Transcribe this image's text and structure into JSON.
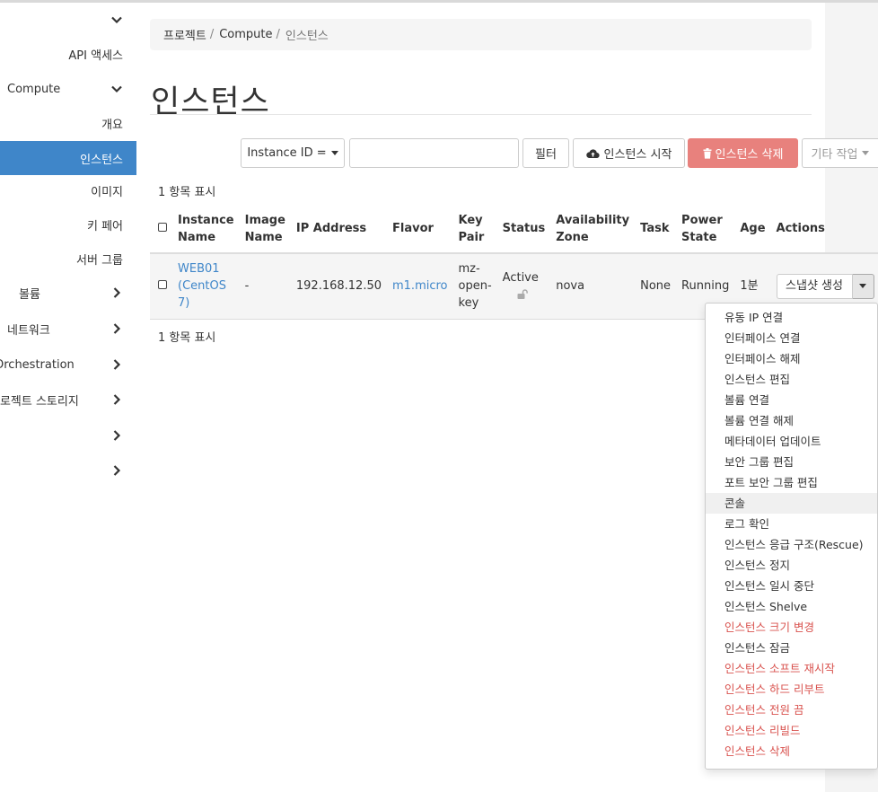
{
  "sidebar": {
    "items": [
      {
        "label": "",
        "chevron": "chevron-down"
      },
      {
        "label": "API 액세스"
      },
      {
        "label": "Compute",
        "chevron": "chevron-down"
      },
      {
        "label": "개요"
      },
      {
        "label": "인스턴스",
        "active": true
      },
      {
        "label": "이미지"
      },
      {
        "label": "키 페어"
      },
      {
        "label": "서버 그룹"
      },
      {
        "label": "볼륨",
        "chevron": "chevron-right"
      },
      {
        "label": "네트워크",
        "chevron": "chevron-right"
      },
      {
        "label": "Orchestration",
        "chevron": "chevron-right"
      },
      {
        "label": "프로젝트 스토리지",
        "chevron": "chevron-right"
      },
      {
        "label": "",
        "chevron": "chevron-right"
      },
      {
        "label": "",
        "chevron": "chevron-right"
      }
    ]
  },
  "breadcrumb": {
    "items": [
      "프로젝트",
      "Compute",
      "인스턴스"
    ],
    "separator": "/"
  },
  "page": {
    "title": "인스턴스"
  },
  "toolbar": {
    "filter_field": "Instance ID =",
    "filter_value": "",
    "filter_button": "필터",
    "launch_button": "인스턴스 시작",
    "delete_button": "인스턴스 삭제",
    "more_button": "기타 작업"
  },
  "summary": {
    "top": "1 항목 표시",
    "bottom": "1 항목 표시"
  },
  "table": {
    "headers": {
      "name": [
        "Instance",
        "Name"
      ],
      "image": [
        "Image",
        "Name"
      ],
      "ip": "IP Address",
      "flavor": "Flavor",
      "keypair": [
        "Key",
        "Pair"
      ],
      "status": "Status",
      "az": [
        "Availability",
        "Zone"
      ],
      "task": "Task",
      "power": [
        "Power",
        "State"
      ],
      "age": "Age",
      "actions": "Actions"
    },
    "rows": [
      {
        "name": [
          "WEB01",
          "(CentOS",
          "7)"
        ],
        "image": "-",
        "ip": "192.168.12.50",
        "flavor": "m1.micro",
        "keypair": [
          "mz-",
          "open-",
          "key"
        ],
        "status": "Active",
        "az": "nova",
        "task": "None",
        "power": "Running",
        "age": "1분",
        "action_primary": "스냅샷 생성"
      }
    ]
  },
  "actions_menu": [
    {
      "label": "유동 IP 연결"
    },
    {
      "label": "인터페이스 연결"
    },
    {
      "label": "인터페이스 해제"
    },
    {
      "label": "인스턴스 편집"
    },
    {
      "label": "볼륨 연결"
    },
    {
      "label": "볼륨 연결 해제"
    },
    {
      "label": "메타데이터 업데이트"
    },
    {
      "label": "보안 그룹 편집"
    },
    {
      "label": "포트 보안 그룹 편집"
    },
    {
      "label": "콘솔",
      "hover": true
    },
    {
      "label": "로그 확인"
    },
    {
      "label": "인스턴스 응급 구조(Rescue)"
    },
    {
      "label": "인스턴스 정지"
    },
    {
      "label": "인스턴스 일시 중단"
    },
    {
      "label": "인스턴스 Shelve"
    },
    {
      "label": "인스턴스 크기 변경",
      "danger": true
    },
    {
      "label": "인스턴스 잠금"
    },
    {
      "label": "인스턴스 소프트 재시작",
      "danger": true
    },
    {
      "label": "인스턴스 하드 리부트",
      "danger": true
    },
    {
      "label": "인스턴스 전원 끔",
      "danger": true
    },
    {
      "label": "인스턴스 리빌드",
      "danger": true
    },
    {
      "label": "인스턴스 삭제",
      "danger": true
    }
  ],
  "colors": {
    "accent": "#3f86c9",
    "danger_button": "#e8817d",
    "danger_text": "#d9534f"
  }
}
